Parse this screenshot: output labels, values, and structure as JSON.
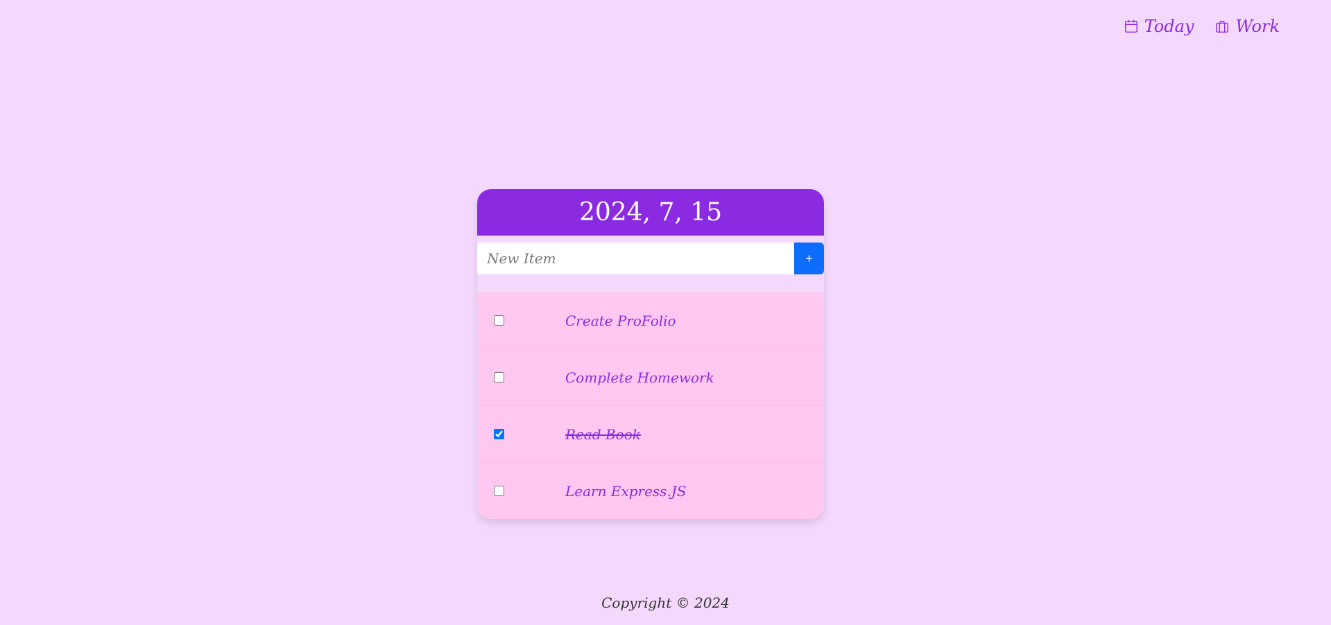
{
  "nav": {
    "links": [
      {
        "label": "Today",
        "icon": "calendar-icon"
      },
      {
        "label": "Work",
        "icon": "briefcase-icon"
      }
    ]
  },
  "card": {
    "title": "2024, 7, 15",
    "input": {
      "placeholder": "New Item",
      "value": ""
    },
    "add_button_label": "+",
    "items": [
      {
        "label": "Create ProFolio",
        "checked": false
      },
      {
        "label": "Complete Homework",
        "checked": false
      },
      {
        "label": "Read Book",
        "checked": true
      },
      {
        "label": "Learn Express.JS",
        "checked": false
      }
    ]
  },
  "footer": {
    "text": "Copyright © 2024"
  },
  "colors": {
    "background": "#f5d9fd",
    "accent": "#8a2be2",
    "button": "#0d6efd",
    "list_bg": "#ffc8f0"
  }
}
